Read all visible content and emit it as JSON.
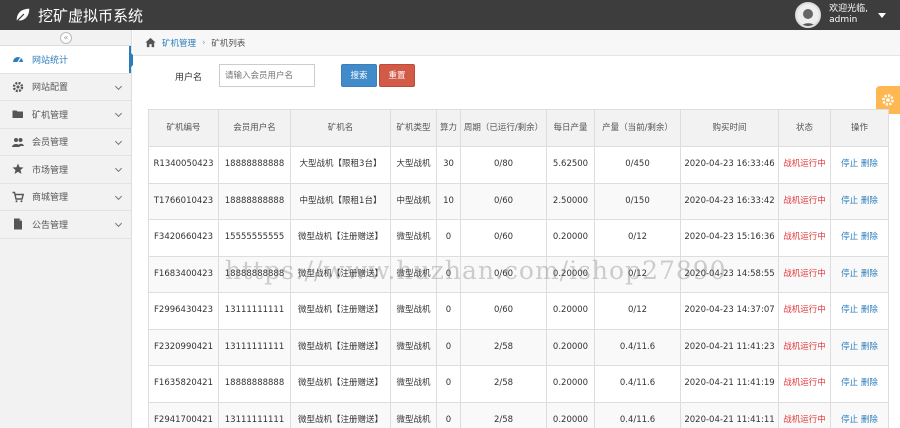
{
  "app": {
    "title": "挖矿虚拟币系统"
  },
  "user": {
    "greeting": "欢迎光临,",
    "name": "admin"
  },
  "sidebar": {
    "items": [
      {
        "label": "网站统计",
        "icon": "dashboard-icon",
        "active": true
      },
      {
        "label": "网站配置",
        "icon": "gear-icon"
      },
      {
        "label": "矿机管理",
        "icon": "folder-icon"
      },
      {
        "label": "会员管理",
        "icon": "users-icon"
      },
      {
        "label": "市场管理",
        "icon": "star-icon"
      },
      {
        "label": "商城管理",
        "icon": "cart-icon"
      },
      {
        "label": "公告管理",
        "icon": "file-icon"
      }
    ]
  },
  "breadcrumb": {
    "parent": "矿机管理",
    "current": "矿机列表"
  },
  "search": {
    "label": "用户名",
    "placeholder": "请输入会员用户名",
    "search_label": "搜索",
    "reset_label": "重置"
  },
  "table": {
    "headers": [
      "矿机编号",
      "会员用户名",
      "矿机名",
      "矿机类型",
      "算力",
      "周期（已运行/剩余）",
      "每日产量",
      "产量（当前/剩余）",
      "购买时间",
      "状态",
      "操作"
    ],
    "rows": [
      {
        "id": "R1340050423",
        "user": "18888888888",
        "name": "大型战机【限租3台】",
        "type": "大型战机",
        "power": "30",
        "cycle": "0/80",
        "daily": "5.62500",
        "output": "0/450",
        "time": "2020-04-23 16:33:46",
        "status": "战机运行中",
        "stop": "停止",
        "del": "删除"
      },
      {
        "id": "T1766010423",
        "user": "18888888888",
        "name": "中型战机【限租1台】",
        "type": "中型战机",
        "power": "10",
        "cycle": "0/60",
        "daily": "2.50000",
        "output": "0/150",
        "time": "2020-04-23 16:33:42",
        "status": "战机运行中",
        "stop": "停止",
        "del": "删除"
      },
      {
        "id": "F3420660423",
        "user": "15555555555",
        "name": "微型战机【注册赠送】",
        "type": "微型战机",
        "power": "0",
        "cycle": "0/60",
        "daily": "0.20000",
        "output": "0/12",
        "time": "2020-04-23 15:16:36",
        "status": "战机运行中",
        "stop": "停止",
        "del": "删除"
      },
      {
        "id": "F1683400423",
        "user": "18888888888",
        "name": "微型战机【注册赠送】",
        "type": "微型战机",
        "power": "0",
        "cycle": "0/60",
        "daily": "0.20000",
        "output": "0/12",
        "time": "2020-04-23 14:58:55",
        "status": "战机运行中",
        "stop": "停止",
        "del": "删除"
      },
      {
        "id": "F2996430423",
        "user": "13111111111",
        "name": "微型战机【注册赠送】",
        "type": "微型战机",
        "power": "0",
        "cycle": "0/60",
        "daily": "0.20000",
        "output": "0/12",
        "time": "2020-04-23 14:37:07",
        "status": "战机运行中",
        "stop": "停止",
        "del": "删除"
      },
      {
        "id": "F2320990421",
        "user": "13111111111",
        "name": "微型战机【注册赠送】",
        "type": "微型战机",
        "power": "0",
        "cycle": "2/58",
        "daily": "0.20000",
        "output": "0.4/11.6",
        "time": "2020-04-21 11:41:23",
        "status": "战机运行中",
        "stop": "停止",
        "del": "删除"
      },
      {
        "id": "F1635820421",
        "user": "18888888888",
        "name": "微型战机【注册赠送】",
        "type": "微型战机",
        "power": "0",
        "cycle": "2/58",
        "daily": "0.20000",
        "output": "0.4/11.6",
        "time": "2020-04-21 11:41:19",
        "status": "战机运行中",
        "stop": "停止",
        "del": "删除"
      },
      {
        "id": "F2941700421",
        "user": "13111111111",
        "name": "微型战机【注册赠送】",
        "type": "微型战机",
        "power": "0",
        "cycle": "2/58",
        "daily": "0.20000",
        "output": "0.4/11.6",
        "time": "2020-04-21 11:41:11",
        "status": "战机运行中",
        "stop": "停止",
        "del": "删除"
      }
    ]
  },
  "watermark": "https://www.huzhan.com/ishop27890",
  "colors": {
    "topbar": "#3d3d3d",
    "accent": "#2b7dbc",
    "status": "#e4393c",
    "search_btn": "#428bca",
    "reset_btn": "#d15b47",
    "settings_tab": "#ffb752"
  }
}
